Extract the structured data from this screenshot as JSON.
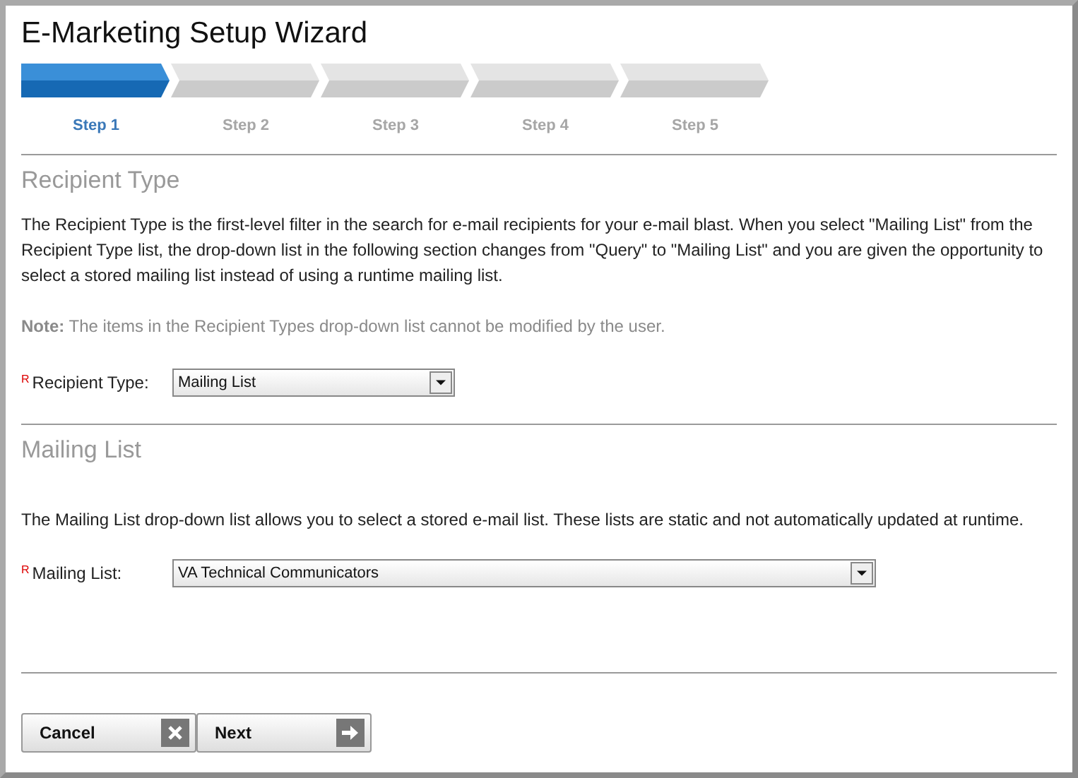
{
  "window": {
    "title": "E-Marketing Setup Wizard"
  },
  "steps": [
    {
      "label": "Step 1",
      "selected": true
    },
    {
      "label": "Step 2",
      "selected": false
    },
    {
      "label": "Step 3",
      "selected": false
    },
    {
      "label": "Step 4",
      "selected": false
    },
    {
      "label": "Step 5",
      "selected": false
    }
  ],
  "sections": [
    {
      "heading": "Recipient Type",
      "paragraphs": [
        "The Recipient Type is the first-level filter in the search for e-mail recipients for your e-mail blast. When you select \"Mailing List\" from the Recipient Type list, the drop-down list in the following section changes from \"Query\" to \"Mailing List\" and you are given the opportunity to select a stored mailing list instead of using a runtime mailing list.",
        "**Note:** The items in the Recipient Types drop-down list cannot be modified by the user."
      ],
      "field": {
        "required_mark": "R",
        "label": "Recipient Type:",
        "value": "Mailing List",
        "wide": false
      }
    },
    {
      "heading": "Mailing List",
      "paragraphs": [
        "The Mailing List drop-down list allows you to select a stored e-mail list. These lists are static and not automatically updated at runtime."
      ],
      "field": {
        "required_mark": "R",
        "label": "Mailing List:",
        "value": "VA Technical Communicators",
        "wide": true
      }
    }
  ],
  "buttons": [
    {
      "label": "Cancel",
      "kind": "cancel"
    },
    {
      "label": "Next",
      "kind": "next"
    }
  ]
}
